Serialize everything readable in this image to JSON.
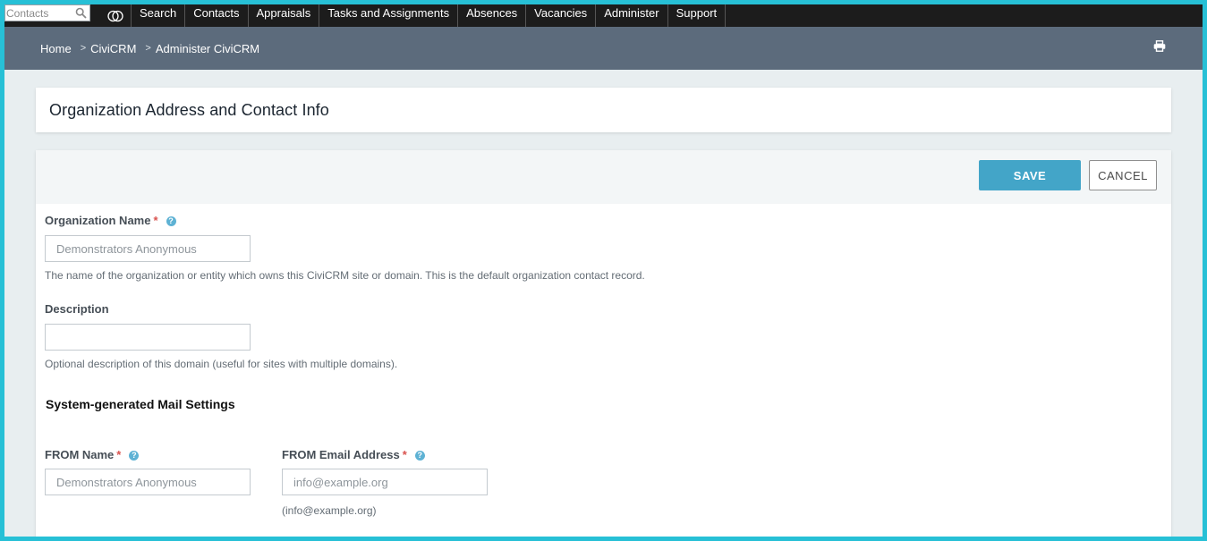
{
  "topnav": {
    "search_placeholder": "Contacts",
    "items": [
      "Search",
      "Contacts",
      "Appraisals",
      "Tasks and Assignments",
      "Absences",
      "Vacancies",
      "Administer",
      "Support"
    ]
  },
  "breadcrumb": [
    "Home",
    "CiviCRM",
    "Administer CiviCRM"
  ],
  "page": {
    "title": "Organization Address and Contact Info"
  },
  "toolbar": {
    "save_label": "SAVE",
    "cancel_label": "CANCEL"
  },
  "form": {
    "org_name": {
      "label": "Organization Name",
      "value": "",
      "placeholder": "Demonstrators Anonymous",
      "help": "The name of the organization or entity which owns this CiviCRM site or domain. This is the default organization contact record."
    },
    "description": {
      "label": "Description",
      "value": "",
      "help": "Optional description of this domain (useful for sites with multiple domains)."
    },
    "mail_section_title": "System-generated Mail Settings",
    "from_name": {
      "label": "FROM Name",
      "value": "",
      "placeholder": "Demonstrators Anonymous"
    },
    "from_email": {
      "label": "FROM Email Address",
      "value": "",
      "placeholder": "info@example.org",
      "help": "(info@example.org)"
    }
  },
  "colors": {
    "accent": "#43a5c8",
    "nav_bg": "#1c1c1c",
    "crumb_bg": "#5c6b7c",
    "required": "#d9534f"
  },
  "icons": [
    "search-icon",
    "civicrm-logo-icon",
    "print-icon",
    "help-icon"
  ]
}
